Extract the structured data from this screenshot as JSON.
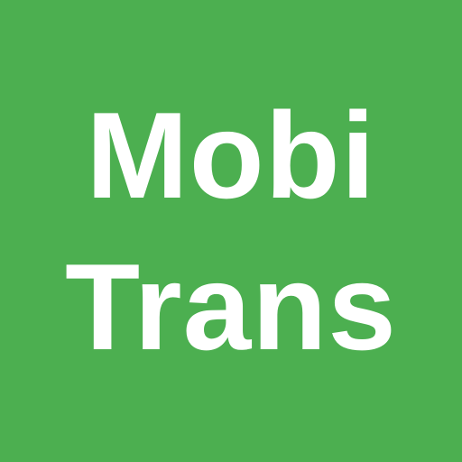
{
  "logo": {
    "line_1": "Mobi",
    "line_2": "Trans",
    "background_color": "#4caf50",
    "text_color": "#ffffff"
  }
}
